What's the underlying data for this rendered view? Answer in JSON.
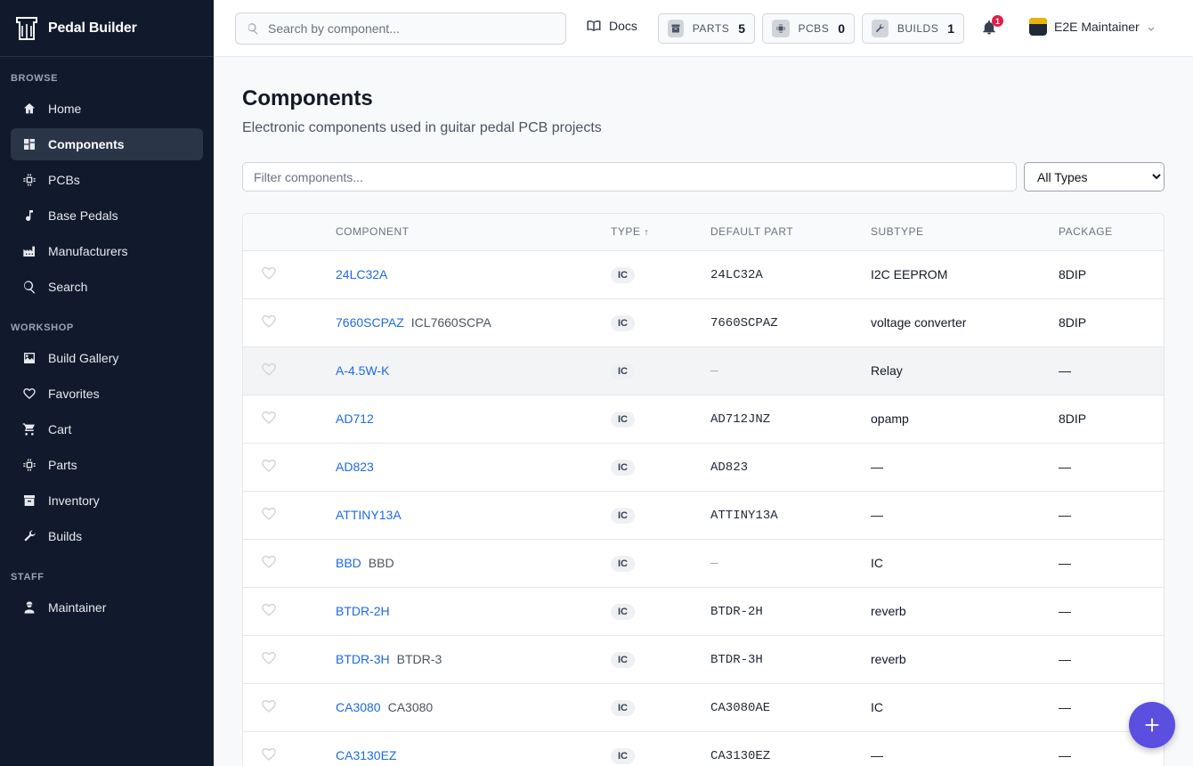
{
  "app": {
    "brand": "Pedal Builder"
  },
  "sidebar": {
    "sections": [
      {
        "title": "BROWSE",
        "items": [
          {
            "label": "Home",
            "icon": "home-icon",
            "active": false
          },
          {
            "label": "Components",
            "icon": "grid-icon",
            "active": true
          },
          {
            "label": "PCBs",
            "icon": "chip-icon",
            "active": false
          },
          {
            "label": "Base Pedals",
            "icon": "music-note-icon",
            "active": false
          },
          {
            "label": "Manufacturers",
            "icon": "factory-icon",
            "active": false
          },
          {
            "label": "Search",
            "icon": "search-icon",
            "active": false
          }
        ]
      },
      {
        "title": "WORKSHOP",
        "items": [
          {
            "label": "Build Gallery",
            "icon": "image-icon",
            "active": false
          },
          {
            "label": "Favorites",
            "icon": "heart-icon",
            "active": false
          },
          {
            "label": "Cart",
            "icon": "cart-icon",
            "active": false
          },
          {
            "label": "Parts",
            "icon": "chip-icon",
            "active": false
          },
          {
            "label": "Inventory",
            "icon": "archive-icon",
            "active": false
          },
          {
            "label": "Builds",
            "icon": "wrench-icon",
            "active": false
          }
        ]
      },
      {
        "title": "STAFF",
        "items": [
          {
            "label": "Maintainer",
            "icon": "engineer-icon",
            "active": false
          }
        ]
      }
    ]
  },
  "topbar": {
    "search_placeholder": "Search by component...",
    "docs_label": "Docs",
    "counters": {
      "parts": {
        "label": "PARTS",
        "value": "5"
      },
      "pcbs": {
        "label": "PCBS",
        "value": "0"
      },
      "builds": {
        "label": "BUILDS",
        "value": "1"
      }
    },
    "notifications_count": "1",
    "user_name": "E2E Maintainer"
  },
  "page": {
    "title": "Components",
    "subtitle": "Electronic components used in guitar pedal PCB projects",
    "filter_placeholder": "Filter components...",
    "type_filter_selected": "All Types"
  },
  "table": {
    "headers": {
      "component": "COMPONENT",
      "type": "TYPE",
      "sort_arrow": "↑",
      "default_part": "DEFAULT PART",
      "subtype": "SUBTYPE",
      "package": "PACKAGE"
    },
    "rows": [
      {
        "name": "24LC32A",
        "alias": "",
        "type": "IC",
        "default_part": "24LC32A",
        "subtype": "I2C EEPROM",
        "package": "8DIP"
      },
      {
        "name": "7660SCPAZ",
        "alias": "ICL7660SCPA",
        "type": "IC",
        "default_part": "7660SCPAZ",
        "subtype": "voltage converter",
        "package": "8DIP"
      },
      {
        "name": "A-4.5W-K",
        "alias": "",
        "type": "IC",
        "default_part": "—",
        "subtype": "Relay",
        "package": "—"
      },
      {
        "name": "AD712",
        "alias": "",
        "type": "IC",
        "default_part": "AD712JNZ",
        "subtype": "opamp",
        "package": "8DIP"
      },
      {
        "name": "AD823",
        "alias": "",
        "type": "IC",
        "default_part": "AD823",
        "subtype": "—",
        "package": "—"
      },
      {
        "name": "ATTINY13A",
        "alias": "",
        "type": "IC",
        "default_part": "ATTINY13A",
        "subtype": "—",
        "package": "—"
      },
      {
        "name": "BBD",
        "alias": "BBD",
        "type": "IC",
        "default_part": "—",
        "subtype": "IC",
        "package": "—"
      },
      {
        "name": "BTDR-2H",
        "alias": "",
        "type": "IC",
        "default_part": "BTDR-2H",
        "subtype": "reverb",
        "package": "—"
      },
      {
        "name": "BTDR-3H",
        "alias": "BTDR-3",
        "type": "IC",
        "default_part": "BTDR-3H",
        "subtype": "reverb",
        "package": "—"
      },
      {
        "name": "CA3080",
        "alias": "CA3080",
        "type": "IC",
        "default_part": "CA3080AE",
        "subtype": "IC",
        "package": "—"
      },
      {
        "name": "CA3130EZ",
        "alias": "",
        "type": "IC",
        "default_part": "CA3130EZ",
        "subtype": "—",
        "package": "—"
      }
    ]
  },
  "colors": {
    "sidebar_bg": "#111a2c",
    "link": "#1d6ae5",
    "fab": "#5b4fe0",
    "badge": "#e11d48"
  }
}
